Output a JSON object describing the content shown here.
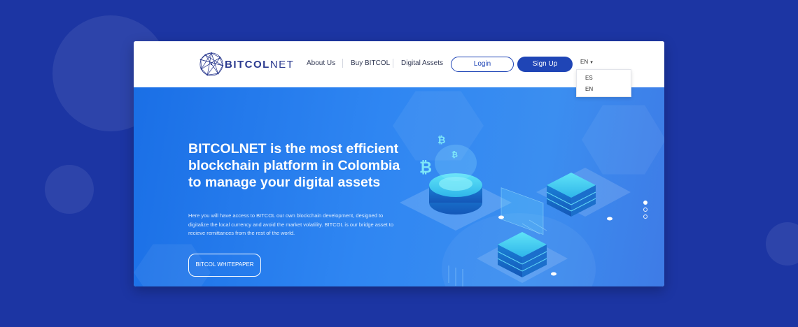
{
  "brand": {
    "name_prefix": "BITCOL",
    "name_suffix": "NET"
  },
  "nav": {
    "links": [
      "About Us",
      "Buy BITCOL",
      "Digital Assets"
    ],
    "login_label": "Login",
    "signup_label": "Sign Up",
    "language": {
      "current": "EN",
      "options": [
        "ES",
        "EN"
      ]
    }
  },
  "hero": {
    "headline": "BITCOLNET is the most efficient blockchain platform in Colombia to manage your digital assets",
    "description": "Here you will have access to BITCOL our own blockchain development, designed to digitalize the local currency and avoid the market volatility. BITCOL is our bridge asset to recieve remittances from the rest of the world.",
    "cta_label": "BITCOL WHITEPAPER",
    "slides": {
      "count": 3,
      "active": 1
    }
  },
  "colors": {
    "background": "#1c35a3",
    "accent": "#1f45b6",
    "hero": "#2f86f2"
  }
}
